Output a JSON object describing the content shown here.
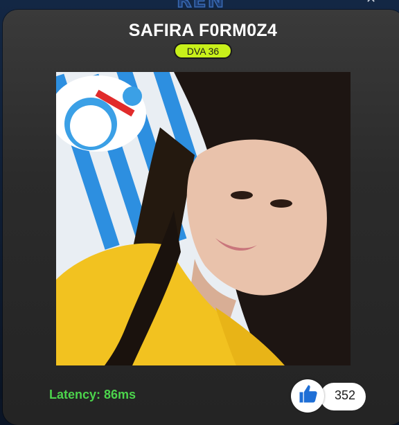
{
  "background": {
    "logo_text": "REN"
  },
  "profile": {
    "name": "SAFIRA F0RM0Z4",
    "badge": "DVA 36",
    "photo_alt": "profile-photo"
  },
  "stats": {
    "latency_label": "Latency: 86ms",
    "likes": "352"
  },
  "colors": {
    "badge_bg": "#c8f01a",
    "latency": "#4cd44c",
    "like_icon": "#1f6fd6",
    "card_bg": "#2f2f2f"
  },
  "icons": {
    "close": "close-icon",
    "like": "thumbs-up-icon"
  }
}
